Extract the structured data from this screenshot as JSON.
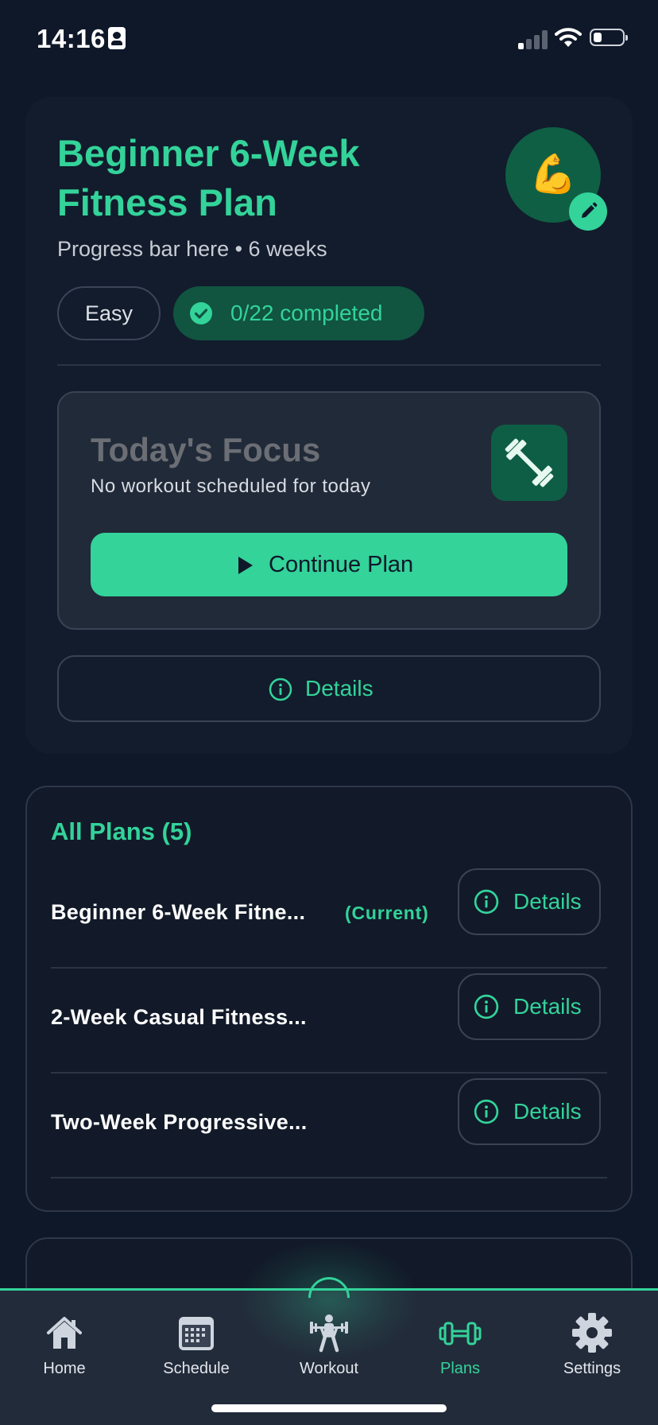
{
  "status_bar": {
    "time": "14:16"
  },
  "plan": {
    "title": "Beginner 6-Week Fitness Plan",
    "subtitle": "Progress bar here • 6 weeks",
    "avatar_emoji": "💪",
    "difficulty": "Easy",
    "completed": "0/22 completed",
    "progress": {
      "done": 0,
      "total": 22
    },
    "focus": {
      "title": "Today's Focus",
      "subtitle": "No workout scheduled for today",
      "continue_label": "Continue Plan"
    },
    "details_label": "Details"
  },
  "all_plans": {
    "heading": "All Plans (5)",
    "items": [
      {
        "name": "Beginner 6-Week Fitne...",
        "tag": "(Current)",
        "details_label": "Details"
      },
      {
        "name": "2-Week Casual Fitness...",
        "tag": "",
        "details_label": "Details"
      },
      {
        "name": "Two-Week Progressive...",
        "tag": "",
        "details_label": "Details"
      }
    ]
  },
  "tab_bar": {
    "items": [
      {
        "label": "Home",
        "icon": "home-icon"
      },
      {
        "label": "Schedule",
        "icon": "calendar-icon"
      },
      {
        "label": "Workout",
        "icon": "weightlifter-icon"
      },
      {
        "label": "Plans",
        "icon": "dumbbell-icon",
        "active": true
      },
      {
        "label": "Settings",
        "icon": "gear-icon"
      }
    ]
  },
  "colors": {
    "accent": "#33d39a",
    "background": "#0f1829",
    "card": "#121c2c",
    "focus_box": "#212a38",
    "tab_bar": "#222b3a"
  }
}
